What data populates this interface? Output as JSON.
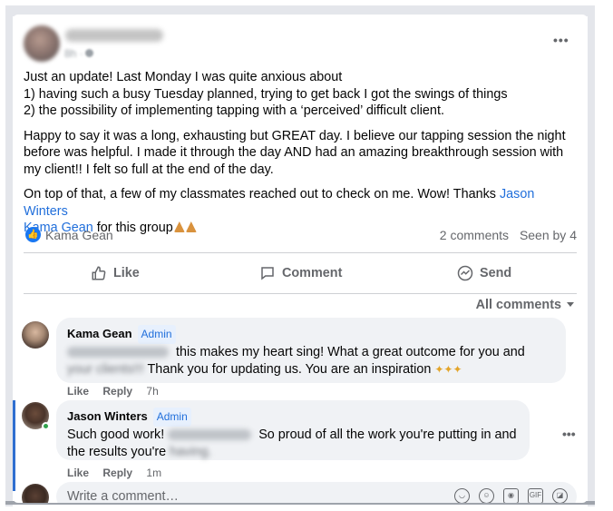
{
  "post": {
    "author_name": "",
    "time": "8h ·",
    "more_label": "•••",
    "paragraphs": [
      "Just an update!  Last Monday I was quite anxious about",
      "1) having such a busy Tuesday planned, trying to get back I got the swings of things",
      "2) the possibility of implementing tapping with a ‘perceived’ difficult client."
    ],
    "paragraph2": "Happy to say it was a long, exhausting but GREAT day. I believe our tapping session the night before was helpful.  I made it through the day AND had an amazing breakthrough session with my client!! I felt so full at the end of the day.",
    "paragraph3_a": "On top of that, a few of my classmates reached out to check on me. Wow! Thanks ",
    "paragraph3_link1": "Jason Winters",
    "paragraph3_b": " and ",
    "paragraph3_link2": "Kama Gean",
    "paragraph3_c": " for this group"
  },
  "reactions": {
    "reactor": "Kama Gean",
    "comments_count": "2 comments",
    "seen_by": "Seen by 4"
  },
  "actions": {
    "like": "Like",
    "comment": "Comment",
    "send": "Send"
  },
  "sort": {
    "label": "All comments"
  },
  "comments": [
    {
      "name": "Kama Gean",
      "role": "Admin",
      "text1": " this makes my heart sing! What a great outcome for you and",
      "text2_blurred": "your clients!!!",
      "text2": " Thank you for updating us. You are an inspiration ",
      "like": "Like",
      "reply": "Reply",
      "time": "7h"
    },
    {
      "name": "Jason Winters",
      "role": "Admin",
      "text1_a": "Such good work!",
      "text1_b": " So proud of all the work you're putting in and",
      "text2": "the results you're",
      "text2_blurred": " having.",
      "like": "Like",
      "reply": "Reply",
      "time": "1m",
      "more_label": "•••"
    }
  ],
  "composer": {
    "placeholder": "Write a comment…"
  },
  "colors": {
    "accent": "#216fdb",
    "like_badge": "#1877f2",
    "bubble": "#f0f2f5",
    "online": "#31a24c"
  },
  "icons": [
    "like-icon",
    "comment-icon",
    "send-icon",
    "sticker-icon",
    "emoji-icon",
    "camera-icon",
    "gif-icon",
    "avatar-sticker-icon"
  ]
}
